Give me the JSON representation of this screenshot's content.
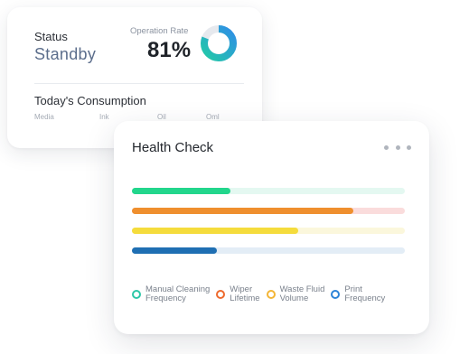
{
  "status_card": {
    "status_label": "Status",
    "status_value": "Standby",
    "rate_label": "Operation Rate",
    "rate_value": "81%",
    "rate_fraction": 0.81,
    "donut_colors": {
      "start": "#22c9a8",
      "end": "#2f8fe6",
      "track": "#e6e9ee"
    },
    "consumption_title": "Today's Consumption",
    "consumption_items": [
      "Media",
      "Ink",
      "Oil",
      "Oml"
    ]
  },
  "health_card": {
    "title": "Health Check",
    "more_icon": "more-horizontal-icon",
    "bars": [
      {
        "name": "Manual Cleaning Frequency",
        "fraction": 0.36,
        "color": "#22d68c",
        "track": "#e4f8f1",
        "track_fraction": 1.0
      },
      {
        "name": "Wiper Lifetime",
        "fraction": 0.81,
        "color": "#ef8f2e",
        "track": "#fadcdc",
        "track_fraction": 1.0
      },
      {
        "name": "Waste Fluid Volume",
        "fraction": 0.61,
        "color": "#f5dc3c",
        "track": "#fbf7dc",
        "track_fraction": 1.0
      },
      {
        "name": "Print Frequency",
        "fraction": 0.31,
        "color": "#1f6fb3",
        "track": "#e3edf6",
        "track_fraction": 1.0
      }
    ],
    "legend": [
      {
        "label": "Manual Cleaning\nFrequency",
        "color": "#2ec7a8"
      },
      {
        "label": "Wiper\nLifetime",
        "color": "#ee6a2e"
      },
      {
        "label": "Waste Fluid\nVolume",
        "color": "#f3b536"
      },
      {
        "label": "Print\nFrequency",
        "color": "#2d84d8"
      }
    ]
  }
}
